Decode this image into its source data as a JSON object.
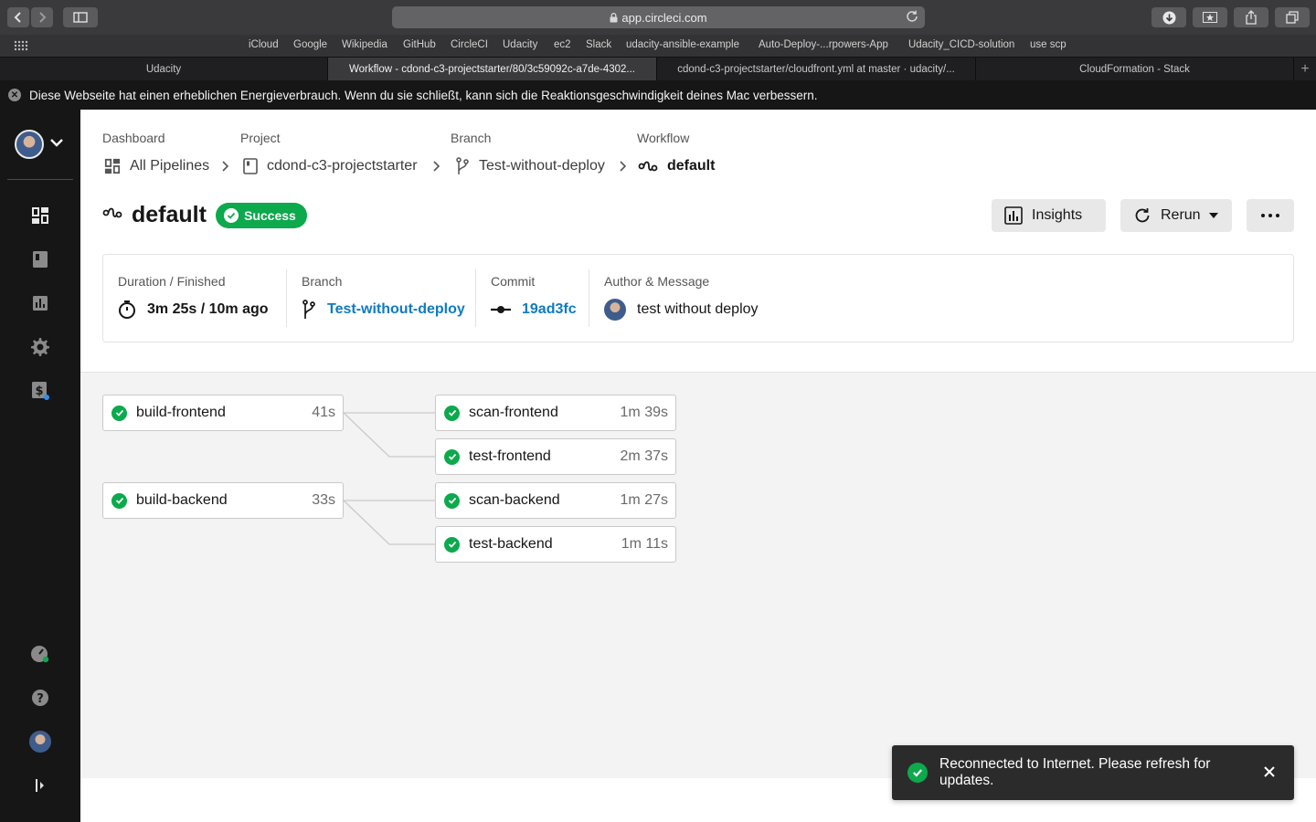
{
  "browser": {
    "url": "app.circleci.com",
    "favorites": [
      "iCloud",
      "Google",
      "Wikipedia",
      "GitHub",
      "CircleCI",
      "Udacity",
      "ec2",
      "Slack",
      "udacity-ansible-example",
      "Auto-Deploy-...rpowers-App",
      "Udacity_CICD-solution",
      "use scp"
    ],
    "tabs": [
      {
        "label": "Udacity",
        "active": false
      },
      {
        "label": "Workflow - cdond-c3-projectstarter/80/3c59092c-a7de-4302...",
        "active": true
      },
      {
        "label": "cdond-c3-projectstarter/cloudfront.yml at master · udacity/...",
        "active": false
      },
      {
        "label": "CloudFormation - Stack",
        "active": false
      }
    ],
    "energy_notice": "Diese Webseite hat einen erheblichen Energieverbrauch. Wenn du sie schließt, kann sich die Reaktionsgeschwindigkeit deines Mac verbessern."
  },
  "breadcrumb": {
    "dashboard": {
      "label": "Dashboard",
      "value": "All Pipelines"
    },
    "project": {
      "label": "Project",
      "value": "cdond-c3-projectstarter"
    },
    "branch": {
      "label": "Branch",
      "value": "Test-without-deploy"
    },
    "workflow": {
      "label": "Workflow",
      "value": "default"
    }
  },
  "workflow": {
    "name": "default",
    "status": "Success",
    "actions": {
      "insights": "Insights",
      "rerun": "Rerun"
    }
  },
  "summary": {
    "duration": {
      "label": "Duration / Finished",
      "value": "3m 25s / 10m ago"
    },
    "branch": {
      "label": "Branch",
      "value": "Test-without-deploy"
    },
    "commit": {
      "label": "Commit",
      "value": "19ad3fc"
    },
    "author": {
      "label": "Author & Message",
      "value": "test without deploy"
    }
  },
  "jobs": {
    "build_frontend": {
      "name": "build-frontend",
      "duration": "41s",
      "status": "success"
    },
    "scan_frontend": {
      "name": "scan-frontend",
      "duration": "1m 39s",
      "status": "success"
    },
    "test_frontend": {
      "name": "test-frontend",
      "duration": "2m 37s",
      "status": "success"
    },
    "build_backend": {
      "name": "build-backend",
      "duration": "33s",
      "status": "success"
    },
    "scan_backend": {
      "name": "scan-backend",
      "duration": "1m 27s",
      "status": "success"
    },
    "test_backend": {
      "name": "test-backend",
      "duration": "1m 11s",
      "status": "success"
    }
  },
  "toast": {
    "message": "Reconnected to Internet. Please refresh for updates."
  },
  "colors": {
    "success": "#0ca94d",
    "link": "#0f7bc1",
    "sidebar": "#161616"
  }
}
